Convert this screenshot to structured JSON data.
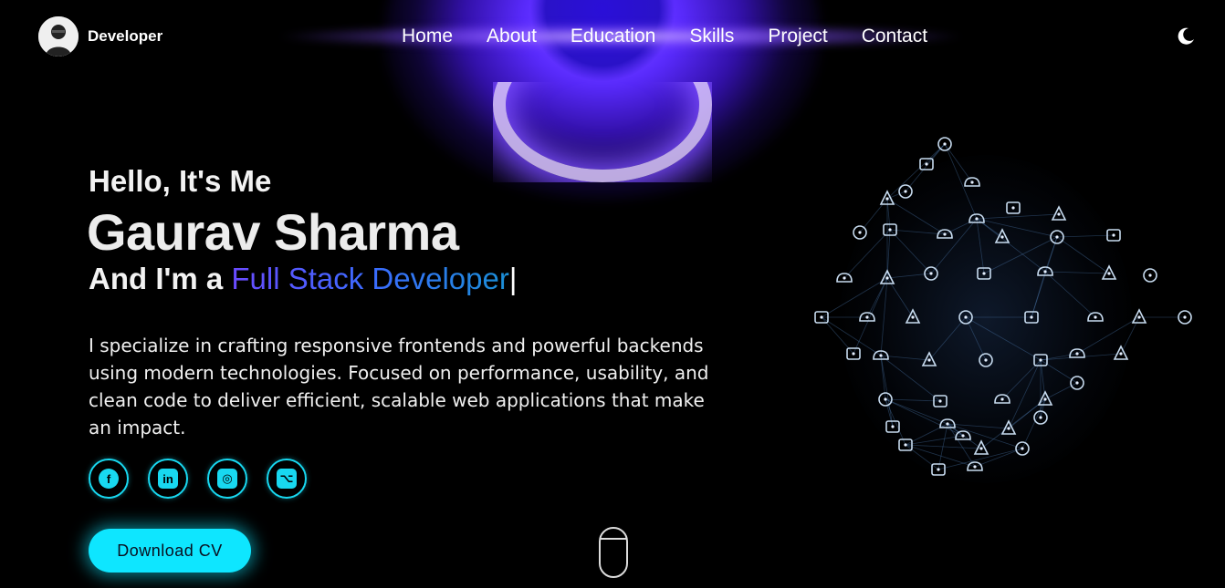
{
  "header": {
    "brand_name": "Developer",
    "nav": [
      "Home",
      "About",
      "Education",
      "Skills",
      "Project",
      "Contact"
    ],
    "theme_icon": "moon-icon"
  },
  "hero": {
    "greeting": "Hello, It's Me",
    "name": "Gaurav Sharma",
    "role_prefix": "And I'm a ",
    "role": "Full Stack Developer",
    "cursor": "|",
    "bio": "I specialize in crafting responsive frontends and powerful backends using modern technologies. Focused on performance, usability, and clean code to deliver efficient, scalable web applications that make an impact.",
    "socials": [
      {
        "name": "facebook-icon",
        "glyph": "f"
      },
      {
        "name": "linkedin-icon",
        "glyph": "in"
      },
      {
        "name": "instagram-icon",
        "glyph": "◎"
      },
      {
        "name": "github-icon",
        "glyph": "⌥"
      }
    ],
    "cv_button": "Download CV"
  },
  "colors": {
    "accent": "#0ee6ff",
    "role_gradient_start": "#6a4bff",
    "role_gradient_end": "#1a8fd6",
    "background": "#000000"
  }
}
